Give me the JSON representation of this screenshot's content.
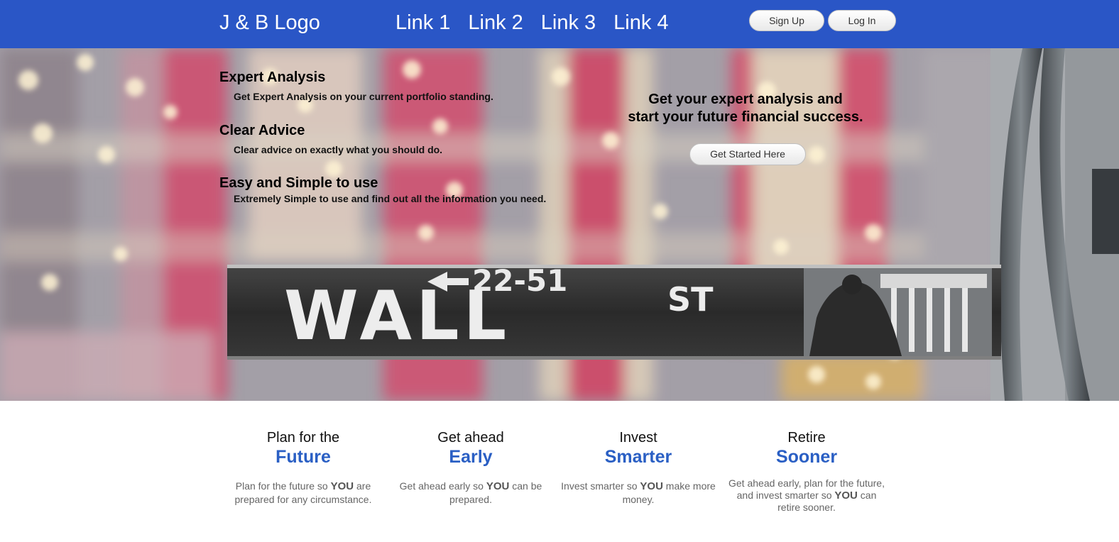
{
  "header": {
    "logo": "J & B Logo",
    "nav": [
      "Link 1",
      "Link 2",
      "Link 3",
      "Link 4"
    ],
    "signup_label": "Sign Up",
    "login_label": "Log In"
  },
  "hero": {
    "features": [
      {
        "title": "Expert Analysis",
        "desc": "Get Expert Analysis on your current portfolio standing."
      },
      {
        "title": "Clear Advice",
        "desc": "Clear advice on exactly what you should do."
      },
      {
        "title": "Easy and Simple to use",
        "desc": "Extremely Simple to use and find out all the information you need."
      }
    ],
    "cta_line1": "Get your expert analysis and",
    "cta_line2": "start your future financial success.",
    "cta_button": "Get Started Here",
    "sign": {
      "number": "22-51",
      "street": "WALL",
      "suffix": "ST"
    }
  },
  "columns": [
    {
      "line1": "Plan for the",
      "line2": "Future",
      "text_pre": "Plan for the future so ",
      "emph": "YOU",
      "text_post": " are prepared for any circumstance."
    },
    {
      "line1": "Get ahead",
      "line2": "Early",
      "text_pre": "Get ahead early so ",
      "emph": "YOU",
      "text_post": " can be prepared."
    },
    {
      "line1": "Invest",
      "line2": "Smarter",
      "text_pre": "Invest smarter so ",
      "emph": "YOU",
      "text_post": " make more money."
    },
    {
      "line1": "Retire",
      "line2": "Sooner",
      "text_pre": "Get ahead early, plan for the future, and invest smarter so ",
      "emph": "YOU",
      "text_post": " can retire sooner."
    }
  ],
  "colors": {
    "header": "#2a56c6",
    "accent": "#2a5fc4"
  }
}
